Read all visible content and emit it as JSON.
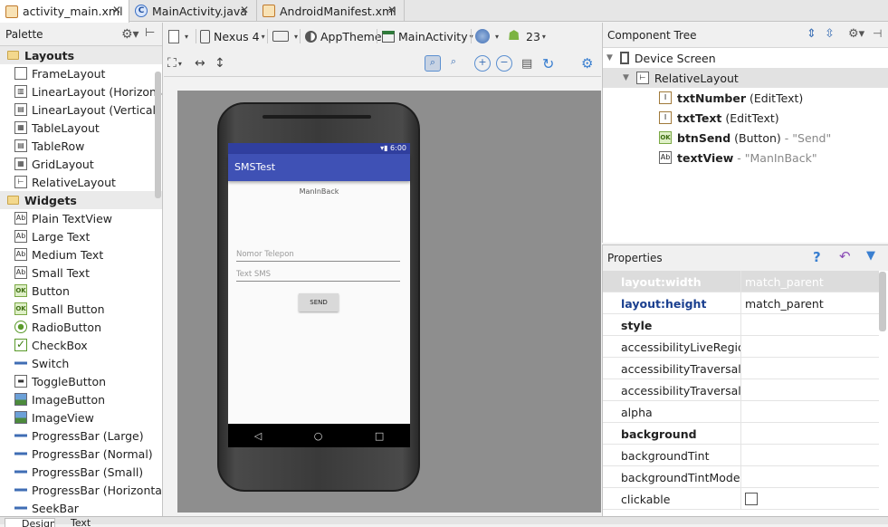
{
  "tabs": [
    {
      "label": "activity_main.xml",
      "type": "xml",
      "active": true
    },
    {
      "label": "MainActivity.java",
      "type": "java",
      "active": false
    },
    {
      "label": "AndroidManifest.xml",
      "type": "xml",
      "active": false
    }
  ],
  "palette": {
    "title": "Palette",
    "groups": [
      {
        "name": "Layouts",
        "items": [
          "FrameLayout",
          "LinearLayout (Horizontal)",
          "LinearLayout (Vertical)",
          "TableLayout",
          "TableRow",
          "GridLayout",
          "RelativeLayout"
        ]
      },
      {
        "name": "Widgets",
        "items": [
          "Plain TextView",
          "Large Text",
          "Medium Text",
          "Small Text",
          "Button",
          "Small Button",
          "RadioButton",
          "CheckBox",
          "Switch",
          "ToggleButton",
          "ImageButton",
          "ImageView",
          "ProgressBar (Large)",
          "ProgressBar (Normal)",
          "ProgressBar (Small)",
          "ProgressBar (Horizontal)",
          "SeekBar"
        ]
      }
    ]
  },
  "toolbar": {
    "device": "Nexus 4",
    "theme": "AppTheme",
    "activity": "MainActivity",
    "api": "23"
  },
  "preview": {
    "status_time": "6:00",
    "app_title": "SMSTest",
    "text_view": "ManInBack",
    "hint_number": "Nomor Telepon",
    "hint_text": "Text SMS",
    "send_label": "SEND",
    "nav_back": "◁",
    "nav_home": "○",
    "nav_recent": "□"
  },
  "component_tree": {
    "title": "Component Tree",
    "root": "Device Screen",
    "layout": "RelativeLayout",
    "children": [
      {
        "id": "txtNumber",
        "type": "(EditText)",
        "extra": ""
      },
      {
        "id": "txtText",
        "type": "(EditText)",
        "extra": ""
      },
      {
        "id": "btnSend",
        "type": "(Button)",
        "extra": "- \"Send\""
      },
      {
        "id": "textView",
        "type": "",
        "extra": "- \"ManInBack\""
      }
    ]
  },
  "properties": {
    "title": "Properties",
    "rows": [
      {
        "key": "layout:width",
        "value": "match_parent"
      },
      {
        "key": "layout:height",
        "value": "match_parent"
      },
      {
        "key": "style",
        "value": ""
      },
      {
        "key": "accessibilityLiveRegion",
        "value": ""
      },
      {
        "key": "accessibilityTraversalAfte",
        "value": ""
      },
      {
        "key": "accessibilityTraversalBefc",
        "value": ""
      },
      {
        "key": "alpha",
        "value": ""
      },
      {
        "key": "background",
        "value": ""
      },
      {
        "key": "backgroundTint",
        "value": ""
      },
      {
        "key": "backgroundTintMode",
        "value": ""
      },
      {
        "key": "clickable",
        "value": ""
      }
    ]
  },
  "bottom_tabs": [
    "Design",
    "Text"
  ],
  "colors": {
    "primary": "#3f51b5",
    "primary_dark": "#303f9f"
  }
}
